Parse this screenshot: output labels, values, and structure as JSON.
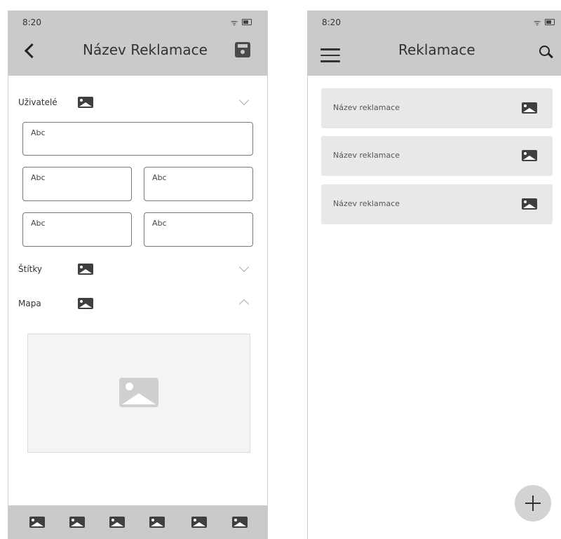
{
  "detail_screen": {
    "status_time": "8:20",
    "title": "Název Reklamace",
    "users_label": "Uživatelé",
    "fields": [
      "Abc",
      "Abc",
      "Abc",
      "Abc",
      "Abc"
    ],
    "tags_label": "Štítky",
    "map_label": "Mapa",
    "bottom_bar_icons": [
      "image-icon",
      "image-icon",
      "image-icon",
      "image-icon",
      "image-icon",
      "image-icon"
    ]
  },
  "list_screen": {
    "status_time": "8:20",
    "title": "Reklamace",
    "items": [
      {
        "label": "Název reklamace"
      },
      {
        "label": "Název reklamace"
      },
      {
        "label": "Název reklamace"
      }
    ]
  },
  "colors": {
    "header_bg": "#cacaca",
    "list_item_bg": "#e8e8e8",
    "fab_bg": "#d3d3d3"
  }
}
